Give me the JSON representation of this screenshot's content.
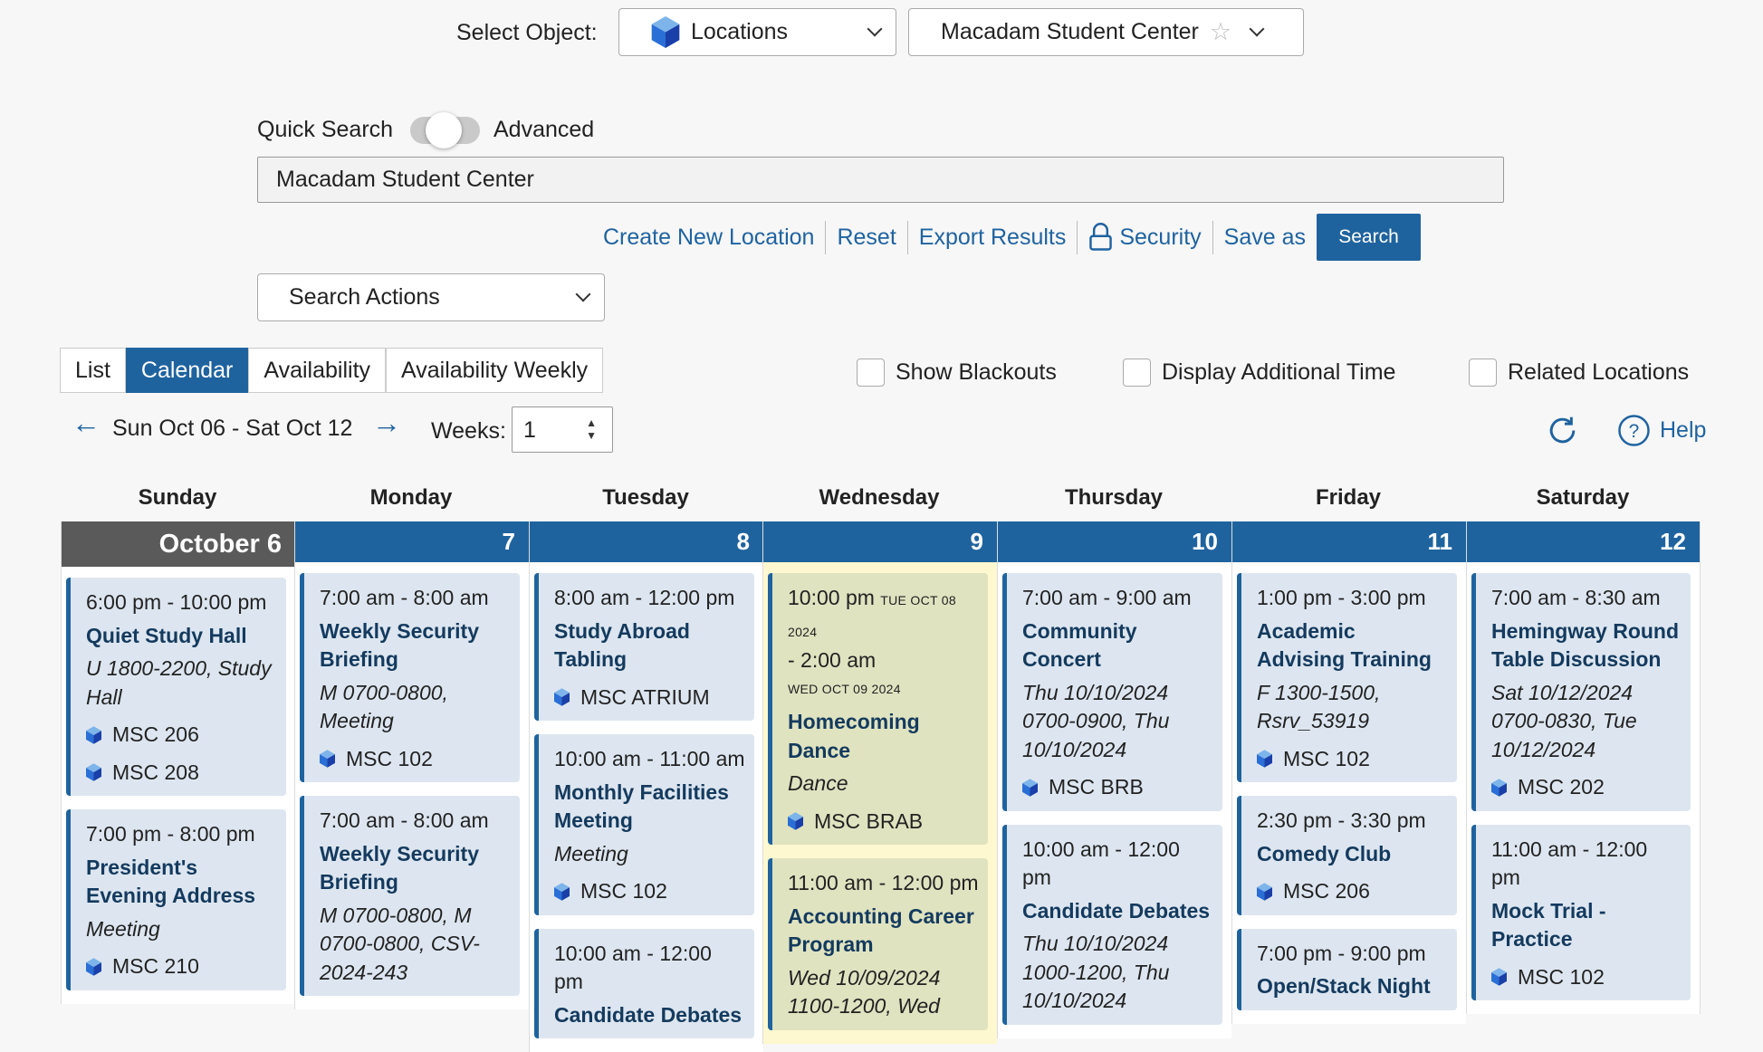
{
  "header": {
    "select_object_label": "Select Object:",
    "object_type": "Locations",
    "object_name": "Macadam Student Center"
  },
  "search": {
    "quick_label": "Quick Search",
    "advanced_label": "Advanced",
    "mode_advanced": false,
    "query": "Macadam Student Center",
    "actions": [
      "Create New Location",
      "Reset",
      "Export Results",
      "Security",
      "Save as"
    ],
    "search_button": "Search",
    "search_actions": "Search Actions"
  },
  "tabs": [
    {
      "label": "List",
      "active": false
    },
    {
      "label": "Calendar",
      "active": true
    },
    {
      "label": "Availability",
      "active": false
    },
    {
      "label": "Availability Weekly",
      "active": false
    }
  ],
  "options": [
    {
      "label": "Show Blackouts",
      "checked": false
    },
    {
      "label": "Display Additional Time",
      "checked": false
    },
    {
      "label": "Related Locations",
      "checked": false
    }
  ],
  "nav": {
    "range": "Sun Oct 06 - Sat Oct 12",
    "weeks_label": "Weeks:",
    "weeks": "1",
    "help": "Help"
  },
  "colors": {
    "accent": "#1f639e",
    "today_header": "#5a5a5a",
    "highlight_column": "#fdf8cf",
    "card": "#dde6f0"
  },
  "calendar": [
    {
      "day": "Sunday",
      "date": "October 6",
      "today": true,
      "events": [
        {
          "time": "6:00 pm - 10:00 pm",
          "title": "Quiet Study Hall",
          "detail": "U 1800-2200, Study Hall",
          "locations": [
            "MSC 206",
            "MSC 208"
          ]
        },
        {
          "time": "7:00 pm - 8:00 pm",
          "title": "President's Evening Address",
          "detail": "Meeting",
          "locations": [
            "MSC 210"
          ]
        }
      ]
    },
    {
      "day": "Monday",
      "date": "7",
      "events": [
        {
          "time": "7:00 am - 8:00 am",
          "title": "Weekly Security Briefing",
          "detail": "M 0700-0800, Meeting",
          "locations": [
            "MSC 102"
          ]
        },
        {
          "time": "7:00 am - 8:00 am",
          "title": "Weekly Security Briefing",
          "detail": "M 0700-0800, M 0700-0800, CSV-2024-243",
          "locations": []
        }
      ]
    },
    {
      "day": "Tuesday",
      "date": "8",
      "events": [
        {
          "time": "8:00 am - 12:00 pm",
          "title": "Study Abroad Tabling",
          "locations": [
            "MSC ATRIUM"
          ]
        },
        {
          "time": "10:00 am - 11:00 am",
          "title": "Monthly Facilities Meeting",
          "detail": "Meeting",
          "locations": [
            "MSC 102"
          ]
        },
        {
          "time": "10:00 am - 12:00 pm",
          "title": "Candidate Debates",
          "locations": []
        }
      ]
    },
    {
      "day": "Wednesday",
      "date": "9",
      "highlight": true,
      "events": [
        {
          "time": "10:00 pm",
          "time_note": "TUE OCT 08 2024",
          "end": "- 2:00 am",
          "end_note": "WED OCT 09 2024",
          "title": "Homecoming Dance",
          "detail": "Dance",
          "locations": [
            "MSC BRAB"
          ]
        },
        {
          "time": "11:00 am - 12:00 pm",
          "title": "Accounting Career Program",
          "detail": "Wed 10/09/2024 1100-1200, Wed",
          "locations": []
        }
      ]
    },
    {
      "day": "Thursday",
      "date": "10",
      "events": [
        {
          "time": "7:00 am - 9:00 am",
          "title": "Community Concert",
          "detail": "Thu 10/10/2024 0700-0900, Thu 10/10/2024",
          "locations": [
            "MSC BRB"
          ]
        },
        {
          "time": "10:00 am - 12:00 pm",
          "title": "Candidate Debates",
          "detail": "Thu 10/10/2024 1000-1200, Thu 10/10/2024",
          "locations": []
        }
      ]
    },
    {
      "day": "Friday",
      "date": "11",
      "events": [
        {
          "time": "1:00 pm - 3:00 pm",
          "title": "Academic Advising Training",
          "detail": "F 1300-1500, Rsrv_53919",
          "locations": [
            "MSC 102"
          ]
        },
        {
          "time": "2:30 pm - 3:30 pm",
          "title": "Comedy Club",
          "locations": [
            "MSC 206"
          ]
        },
        {
          "time": "7:00 pm - 9:00 pm",
          "title": "Open/Stack Night",
          "locations": []
        }
      ]
    },
    {
      "day": "Saturday",
      "date": "12",
      "events": [
        {
          "time": "7:00 am - 8:30 am",
          "title": "Hemingway Round Table Discussion",
          "detail": "Sat 10/12/2024 0700-0830, Tue 10/12/2024",
          "locations": [
            "MSC 202"
          ]
        },
        {
          "time": "11:00 am - 12:00 pm",
          "title": "Mock Trial - Practice",
          "locations": [
            "MSC 102"
          ]
        }
      ]
    }
  ]
}
